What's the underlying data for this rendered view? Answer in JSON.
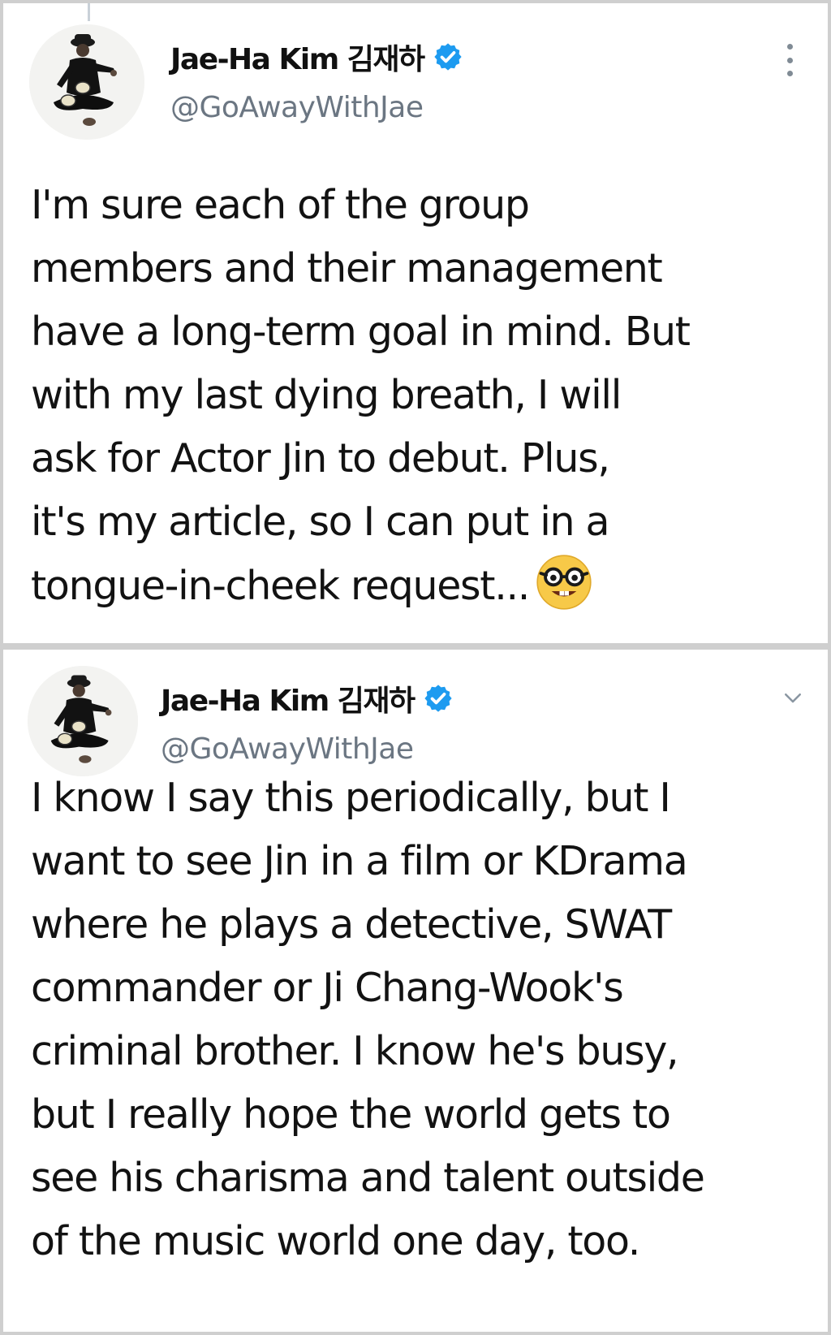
{
  "tweets": [
    {
      "author": {
        "display_name": "Jae-Ha Kim 김재하",
        "handle": "@GoAwayWithJae"
      },
      "menu_icon": "more-vertical-icon",
      "text_lines": [
        "I'm sure each of the group",
        "members and their management",
        "have a long-term goal in mind. But",
        "with my last dying breath, I will",
        "ask for Actor Jin to debut. Plus,",
        "it's my article, so I can put in a",
        "tongue-in-cheek request..."
      ],
      "emoji": "nerd-face-emoji"
    },
    {
      "author": {
        "display_name": "Jae-Ha Kim 김재하",
        "handle": "@GoAwayWithJae"
      },
      "menu_icon": "chevron-down-icon",
      "text_lines": [
        "I know I say this periodically, but I",
        "want to see Jin in a film or KDrama",
        "where he plays a detective, SWAT",
        "commander or Ji Chang-Wook's",
        "criminal brother. I know he's busy,",
        "but I really hope the world gets to",
        "see his charisma and talent outside",
        "of the music world one day, too."
      ]
    }
  ],
  "colors": {
    "verified_badge": "#1d9bf0",
    "handle_text": "#6b7682",
    "body_text": "#121212",
    "frame": "#cfcfcf"
  }
}
